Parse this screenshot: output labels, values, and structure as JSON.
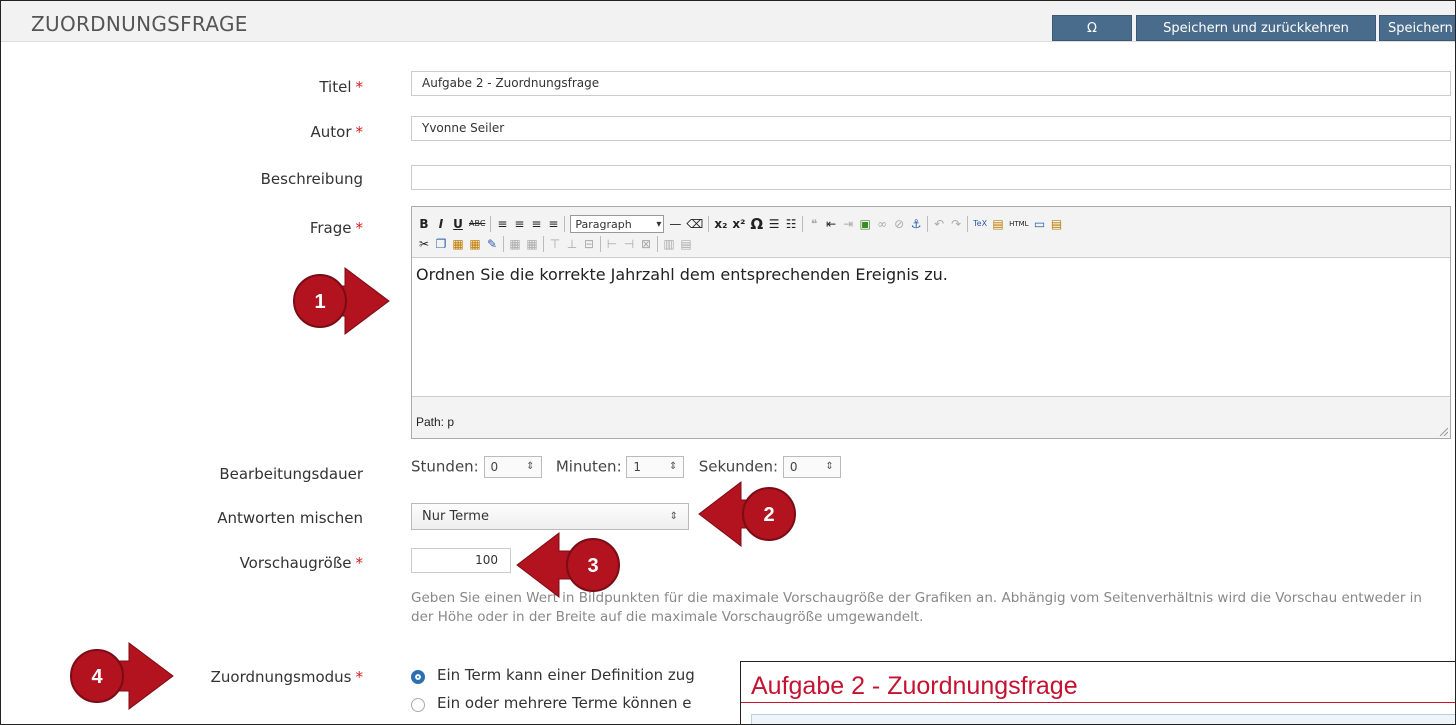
{
  "header": {
    "title": "ZUORDNUNGSFRAGE",
    "omega_button": "Ω",
    "save_return_button": "Speichern und zurückkehren",
    "save_button": "Speichern"
  },
  "required_marker": "*",
  "form": {
    "title": {
      "label": "Titel",
      "value": "Aufgabe 2 - Zuordnungsfrage"
    },
    "author": {
      "label": "Autor",
      "value": "Yvonne Seiler"
    },
    "description": {
      "label": "Beschreibung",
      "value": ""
    },
    "question": {
      "label": "Frage",
      "paragraph_format": "Paragraph",
      "content": "Ordnen Sie die korrekte Jahrzahl dem entsprechenden Ereignis zu.",
      "path": "Path: p"
    },
    "duration": {
      "label": "Bearbeitungsdauer",
      "hours_label": "Stunden:",
      "hours_value": "0",
      "minutes_label": "Minuten:",
      "minutes_value": "1",
      "seconds_label": "Sekunden:",
      "seconds_value": "0"
    },
    "shuffle": {
      "label": "Antworten mischen",
      "value": "Nur Terme"
    },
    "preview_size": {
      "label": "Vorschaugröße",
      "value": "100",
      "hint": "Geben Sie einen Wert in Bildpunkten für die maximale Vorschaugröße der Grafiken an. Abhängig vom Seitenverhältnis wird die Vorschau entweder in der Höhe oder in der Breite auf die maximale Vorschaugröße umgewandelt."
    },
    "mode": {
      "label": "Zuordnungsmodus",
      "options": [
        "Ein Term kann einer Definition zug",
        "Ein oder mehrere Terme können e"
      ],
      "selected_index": 0
    }
  },
  "preview_overlay": {
    "title": "Aufgabe 2 - Zuordnungsfrage"
  },
  "callouts": [
    "1",
    "2",
    "3",
    "4"
  ],
  "colors": {
    "callout_red": "#b3121f",
    "header_button": "#4a6c8c",
    "required": "#d61f1f",
    "preview_title": "#c41230"
  }
}
